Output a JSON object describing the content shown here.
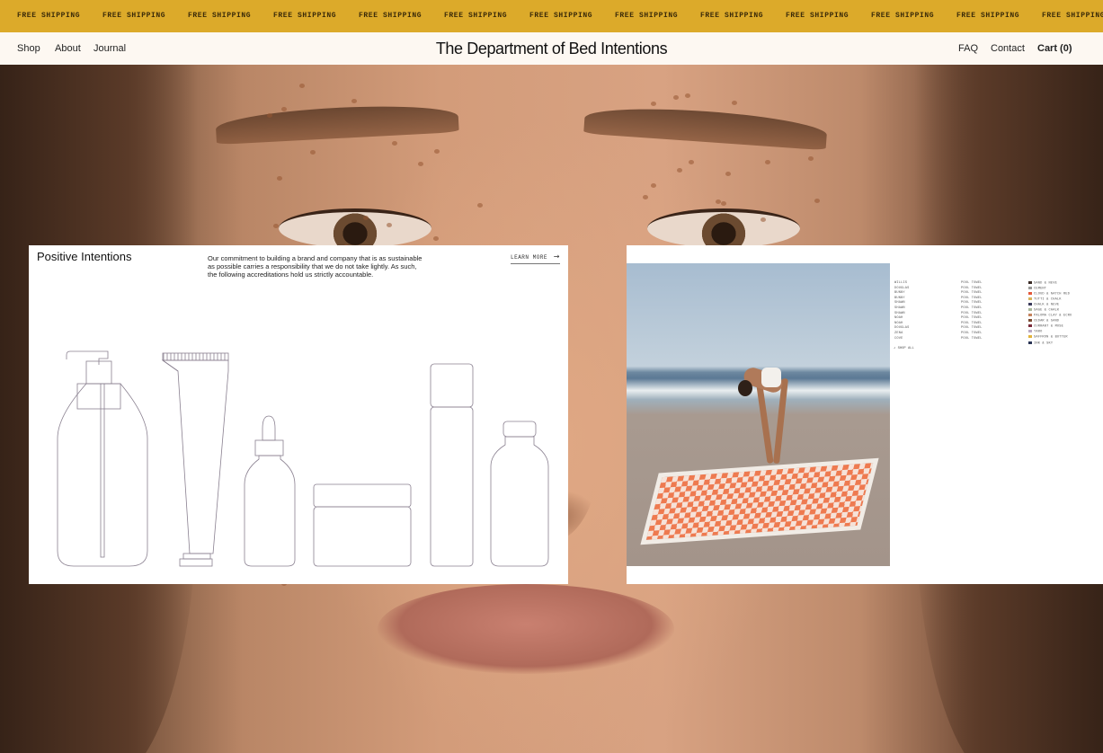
{
  "ticker": {
    "items": [
      "FREE SHIPPING",
      "FREE SHIPPING",
      "FREE SHIPPING",
      "FREE SHIPPING",
      "FREE SHIPPING",
      "FREE SHIPPING",
      "FREE SHIPPING",
      "FREE SHIPPING",
      "FREE SHIPPING",
      "FREE SHIPPING",
      "FREE SHIPPING",
      "FREE SHIPPING",
      "FREE SHIPPING"
    ]
  },
  "nav": {
    "left": [
      "Shop",
      "About",
      "Journal"
    ],
    "brand": "The Department of Bed Intentions",
    "right": [
      "FAQ",
      "Contact",
      "Cart (0)"
    ]
  },
  "left_panel": {
    "title": "Positive Intentions",
    "text": "Our commitment to building a brand and company that is as sustainable as possible carries a responsibility that we do not take lightly. As such, the following accreditations hold us strictly accountable.",
    "learn_more": "LEARN MORE",
    "arrow_icon": "→"
  },
  "right_panel": {
    "names": [
      "WILLIS",
      "DOUGLAS",
      "BUNNY",
      "BUNNY",
      "SHAWN",
      "SHAWN",
      "SHAWN",
      "NOAH",
      "NOAH",
      "DOUGLAS",
      "ZENA",
      "COVE"
    ],
    "types": [
      "POOL TOWEL",
      "POOL TOWEL",
      "POOL TOWEL",
      "POOL TOWEL",
      "POOL TOWEL",
      "POOL TOWEL",
      "POOL TOWEL",
      "POOL TOWEL",
      "POOL TOWEL",
      "POOL TOWEL",
      "POOL TOWEL",
      "POOL TOWEL"
    ],
    "colorways": [
      {
        "label": "SAND & NEVE",
        "color": "#3a2a24"
      },
      {
        "label": "CEMENT",
        "color": "#9a9a98"
      },
      {
        "label": "CLOUD & NATCH RED",
        "color": "#e3583a"
      },
      {
        "label": "TUTTI & CHALK",
        "color": "#d8b35a"
      },
      {
        "label": "CHALK & NEVE",
        "color": "#3a3a5a"
      },
      {
        "label": "SAGE & CHALK",
        "color": "#a9b79a"
      },
      {
        "label": "PALOMA CLAY & ECRU",
        "color": "#c4825c"
      },
      {
        "label": "CEDAR & SAND",
        "color": "#7a4a30"
      },
      {
        "label": "CURRANT & MUSE",
        "color": "#7a2a3a"
      },
      {
        "label": "TARO",
        "color": "#b9a9c4"
      },
      {
        "label": "SAFFRON & BUTTER",
        "color": "#e2b23a"
      },
      {
        "label": "INK & SKY",
        "color": "#2a3454"
      }
    ],
    "shop_all": "SHOP ALL"
  }
}
